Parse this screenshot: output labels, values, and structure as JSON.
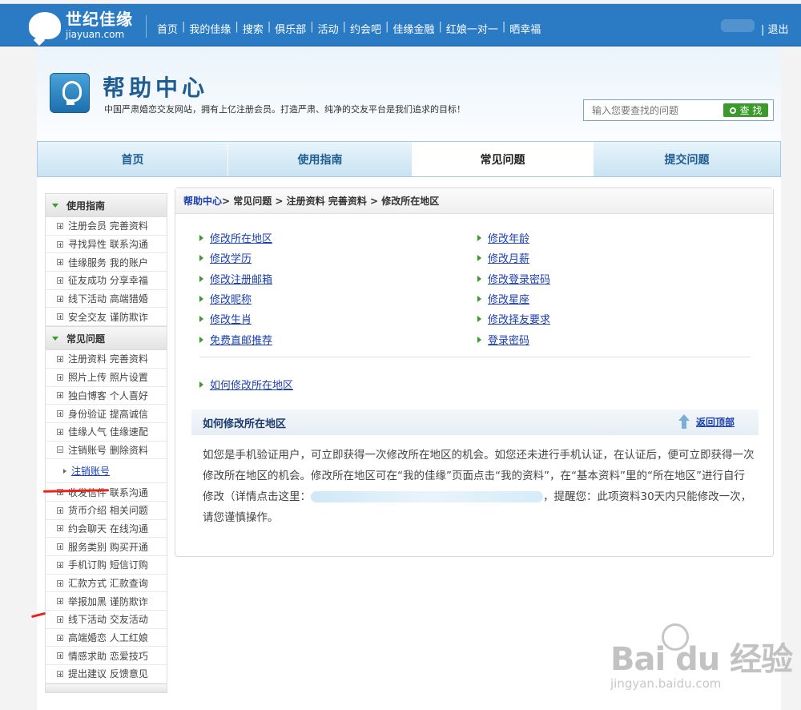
{
  "topbar": {
    "logo_cn": "世纪佳缘",
    "logo_en": "jiayuan.com",
    "nav": [
      "首页",
      "我的佳缘",
      "搜索",
      "俱乐部",
      "活动",
      "约会吧",
      "佳缘金融",
      "红娘一对一",
      "晒幸福"
    ],
    "logout": "退出"
  },
  "banner": {
    "title": "帮助中心",
    "subtitle": "中国严肃婚恋交友网站，拥有上亿注册会员。打造严肃、纯净的交友平台是我们追求的目标！",
    "search_placeholder": "输入您要查找的问题",
    "search_button": "查 找"
  },
  "tabs": [
    "首页",
    "使用指南",
    "常见问题",
    "提交问题"
  ],
  "sidebar": {
    "section1_title": "使用指南",
    "section1_items": [
      "注册会员 完善资料",
      "寻找异性 联系沟通",
      "佳缘服务 我的账户",
      "征友成功 分享幸福",
      "线下活动 高端猎婚",
      "安全交友 谨防欺诈"
    ],
    "section2_title": "常见问题",
    "section2_items_a": [
      "注册资料 完善资料",
      "照片上传 照片设置",
      "独白博客 个人喜好",
      "身份验证 提高诚信",
      "佳缘人气 佳缘速配",
      "注销账号 删除资料"
    ],
    "sub_item": "注销账号",
    "section2_items_b": [
      "收发信件 联系沟通",
      "货币介绍 相关问题",
      "约会聊天 在线沟通",
      "服务类别 购买开通",
      "手机订购 短信订购",
      "汇款方式 汇款查询",
      "举报加黑 谨防欺诈",
      "线下活动 交友活动",
      "高端婚恋 人工红娘",
      "情感求助 恋爱技巧",
      "提出建议 反馈意见"
    ]
  },
  "content": {
    "crumb_home": "帮助中心",
    "crumb_rest": " > 常见问题 > 注册资料 完善资料 > 修改所在地区",
    "links_left": [
      "修改所在地区",
      "修改学历",
      "修改注册邮箱",
      "修改昵称",
      "修改生肖",
      "免费直邮推荐"
    ],
    "links_right": [
      "修改年龄",
      "修改月薪",
      "修改登录密码",
      "修改星座",
      "修改择友要求",
      "登录密码"
    ],
    "related_link": "如何修改所在地区",
    "section_title": "如何修改所在地区",
    "back_top": "返回顶部",
    "body_part1": "如您是手机验证用户，可立即获得一次修改所在地区的机会。如您还未进行手机认证，在认证后，便可立即获得一次修改所在地区的机会。修改所在地区可在“我的佳缘”页面点击“我的资料”，在“基本资料”里的“所在地区”进行自行修改（详情点击这里：",
    "body_part2": "，提醒您：此项资料30天内只能修改一次，请您谨慎操作。"
  },
  "watermark": {
    "brand": "Bai du 经验",
    "url": "jingyan.baidu.com"
  }
}
